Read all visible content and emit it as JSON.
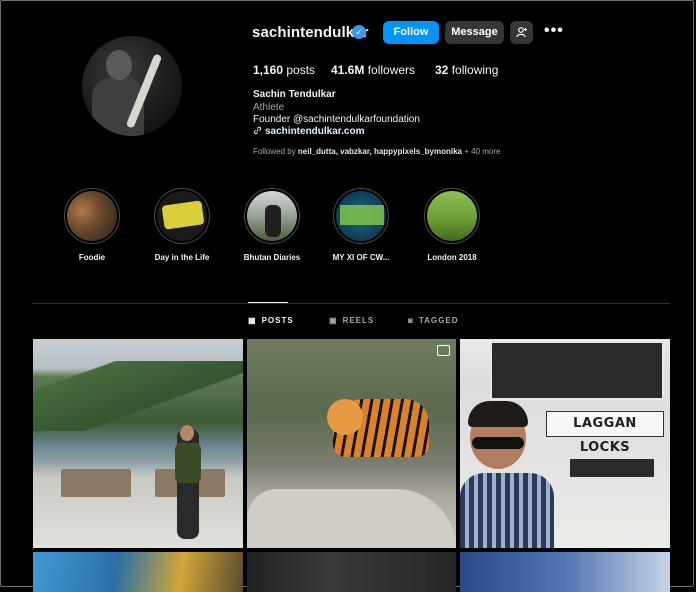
{
  "profile": {
    "username": "sachintendulkar",
    "verified_icon": "verified-badge-icon",
    "follow_label": "Follow",
    "message_label": "Message",
    "suggest_icon": "person-add-icon",
    "more_icon": "more-options-icon",
    "stats": {
      "posts": "1,160",
      "posts_label": "posts",
      "followers": "41.6M",
      "followers_label": "followers",
      "following": "32",
      "following_label": "following"
    },
    "full_name": "Sachin Tendulkar",
    "category": "Athlete",
    "bio": "Founder @sachintendulkarfoundation",
    "link": "sachintendulkar.com",
    "followed_by_prefix": "Followed by",
    "followed_by_names": "neil_dutta, vabzkar, happypixels_bymonika",
    "followed_by_more": "+ 40 more"
  },
  "highlights": [
    {
      "label": "Foodie"
    },
    {
      "label": "Day in the Life"
    },
    {
      "label": "Bhutan Diaries"
    },
    {
      "label": "MY XI OF CW..."
    },
    {
      "label": "London 2018"
    }
  ],
  "tabs": [
    {
      "label": "POSTS",
      "icon": "grid-icon",
      "active": true
    },
    {
      "label": "REELS",
      "icon": "reels-icon",
      "active": false
    },
    {
      "label": "TAGGED",
      "icon": "tagged-icon",
      "active": false
    }
  ],
  "posts": {
    "post3_sign_text": "LAGGAN LOCKS"
  },
  "colors": {
    "background": "#000000",
    "follow_button": "#0095f6",
    "secondary_button": "#363636",
    "verified": "#3897f0"
  }
}
